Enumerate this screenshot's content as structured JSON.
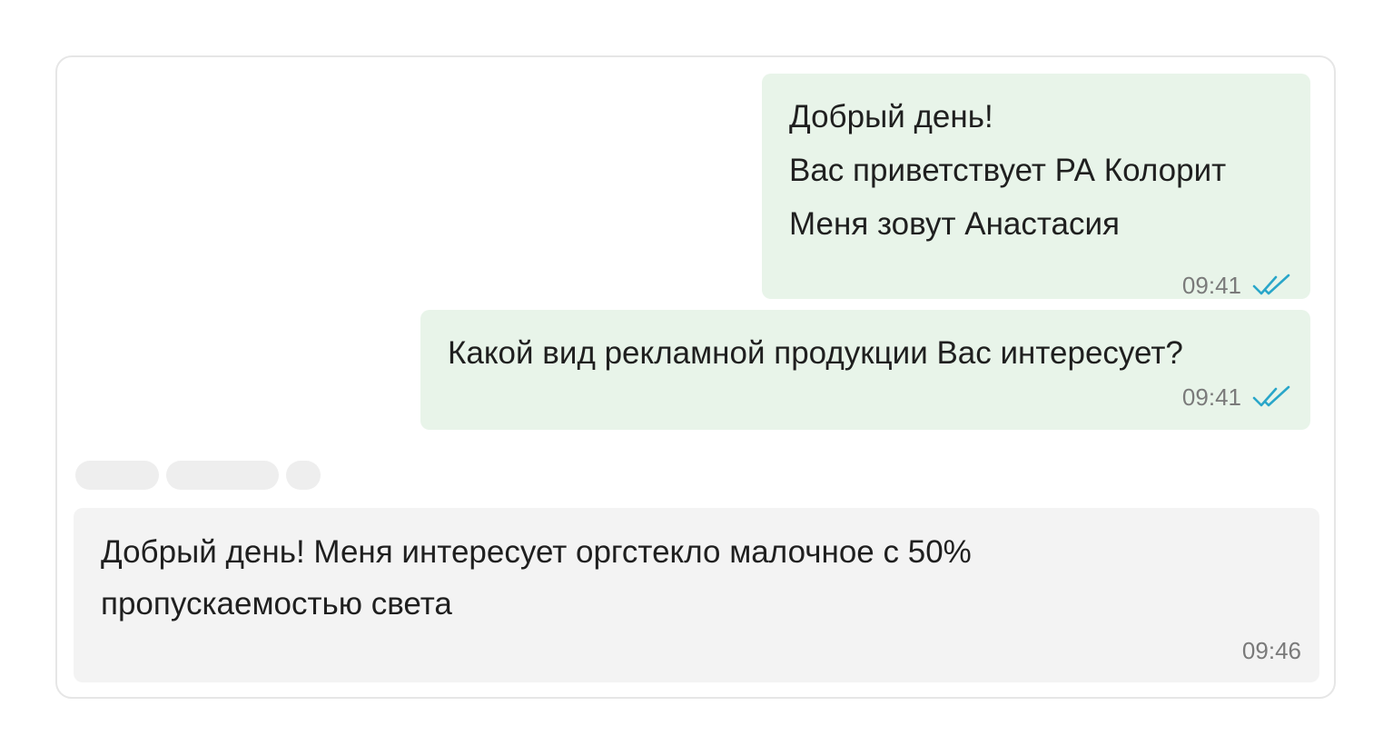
{
  "messages": [
    {
      "direction": "outgoing",
      "text": "Добрый день!\nВас приветствует РА Колорит\nМеня зовут Анастасия",
      "time": "09:41",
      "status_icon": "double-check-icon"
    },
    {
      "direction": "outgoing",
      "text": "Какой вид рекламной продукции Вас интересует?",
      "time": "09:41",
      "status_icon": "double-check-icon"
    },
    {
      "direction": "incoming",
      "text": "Добрый день! Меня интересует оргстекло малочное с 50% пропускаемостью света",
      "time": "09:46"
    }
  ],
  "colors": {
    "outgoing_bubble": "#e8f4e9",
    "incoming_bubble": "#f3f3f3",
    "check_mark": "#29a6c9",
    "time_text": "#7a7a7a"
  }
}
